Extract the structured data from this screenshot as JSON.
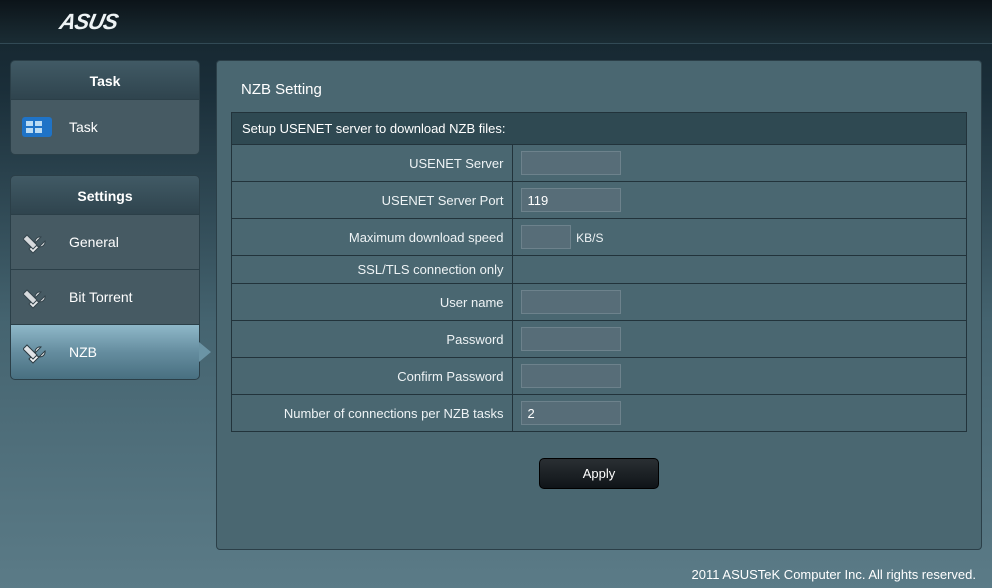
{
  "brand": "ASUS",
  "sidebar": {
    "task_header": "Task",
    "task_items": [
      {
        "label": "Task"
      }
    ],
    "settings_header": "Settings",
    "settings_items": [
      {
        "label": "General"
      },
      {
        "label": "Bit Torrent"
      },
      {
        "label": "NZB",
        "active": true
      }
    ]
  },
  "panel": {
    "title": "NZB Setting",
    "section_header": "Setup USENET server to download NZB files:",
    "fields": {
      "usenet_server_label": "USENET Server",
      "usenet_server_value": "",
      "usenet_port_label": "USENET Server Port",
      "usenet_port_value": "119",
      "max_speed_label": "Maximum download speed",
      "max_speed_value": "",
      "max_speed_unit": "KB/S",
      "ssl_label": "SSL/TLS connection only",
      "username_label": "User name",
      "username_value": "",
      "password_label": "Password",
      "password_value": "",
      "confirm_label": "Confirm Password",
      "confirm_value": "",
      "connections_label": "Number of connections per NZB tasks",
      "connections_value": "2"
    },
    "apply_label": "Apply"
  },
  "footer": "2011 ASUSTeK Computer Inc. All rights reserved."
}
